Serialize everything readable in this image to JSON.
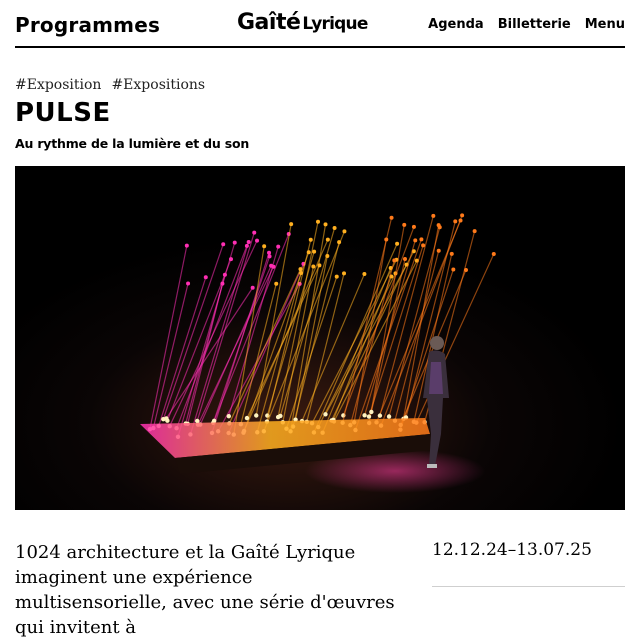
{
  "header": {
    "programmes_label": "Programmes",
    "logo_main": "Gaîté",
    "logo_sub": "Lyrique",
    "nav": [
      {
        "label": "Agenda"
      },
      {
        "label": "Billetterie"
      },
      {
        "label": "Menu"
      }
    ]
  },
  "tags": [
    "#Exposition",
    "#Expositions"
  ],
  "title": "PULSE",
  "subtitle": "Au rythme de la lumière et du son",
  "hero": {
    "icon": "light-installation-image",
    "colors": {
      "warm": "#ffb020",
      "magenta": "#ff2fb4",
      "orange": "#ff7a1a",
      "background": "#000000"
    }
  },
  "description": "1024 architecture et la Gaîté Lyrique imaginent une expérience multisensorielle, avec une série d'œuvres qui invitent à",
  "dates": "12.12.24–13.07.25"
}
